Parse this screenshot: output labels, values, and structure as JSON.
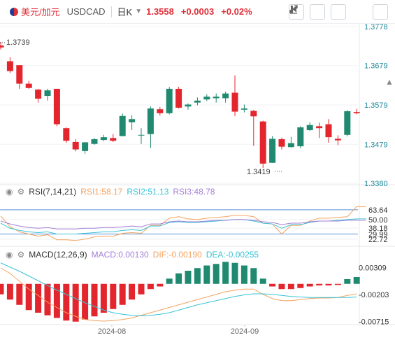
{
  "toolbar": {
    "symbol": "美元/加元",
    "code": "USDCAD",
    "period": "日K",
    "price": "1.3558",
    "change": "+0.0003",
    "change_pct": "+0.02%"
  },
  "colors": {
    "up": "#1f8a70",
    "down": "#e3262d",
    "rsi1": "#f5a25d",
    "rsi2": "#38c3d6",
    "rsi3": "#a57fd6",
    "dif": "#f5a25d",
    "dea": "#38c3d6",
    "axis_text": "#1f8a9a"
  },
  "icons": [
    "flag-icon",
    "chevron-down-icon",
    "draw-icon",
    "alert-icon",
    "settings-icon",
    "expand-icon",
    "close-icon",
    "eye-icon",
    "gear-icon"
  ],
  "chart_data": [
    {
      "type": "candlestick",
      "yticks": [
        "1.3778",
        "1.3679",
        "1.3579",
        "1.3479",
        "1.3380"
      ],
      "ylim": [
        1.338,
        1.3778
      ],
      "annotations": {
        "high_label": "1.3739",
        "low_label": "1.3419"
      },
      "candles": [
        {
          "o": 1.373,
          "h": 1.3739,
          "l": 1.372,
          "c": 1.3725
        },
        {
          "o": 1.369,
          "h": 1.37,
          "l": 1.366,
          "c": 1.3665
        },
        {
          "o": 1.368,
          "h": 1.368,
          "l": 1.362,
          "c": 1.3633
        },
        {
          "o": 1.3633,
          "h": 1.364,
          "l": 1.362,
          "c": 1.3622
        },
        {
          "o": 1.3618,
          "h": 1.362,
          "l": 1.3585,
          "c": 1.3595
        },
        {
          "o": 1.3602,
          "h": 1.362,
          "l": 1.359,
          "c": 1.3616
        },
        {
          "o": 1.362,
          "h": 1.362,
          "l": 1.3525,
          "c": 1.353
        },
        {
          "o": 1.352,
          "h": 1.3522,
          "l": 1.3483,
          "c": 1.3488
        },
        {
          "o": 1.3485,
          "h": 1.3492,
          "l": 1.3461,
          "c": 1.3466
        },
        {
          "o": 1.3462,
          "h": 1.3485,
          "l": 1.3455,
          "c": 1.3484
        },
        {
          "o": 1.348,
          "h": 1.3495,
          "l": 1.3478,
          "c": 1.3492
        },
        {
          "o": 1.349,
          "h": 1.3503,
          "l": 1.3487,
          "c": 1.3497
        },
        {
          "o": 1.3495,
          "h": 1.3505,
          "l": 1.3485,
          "c": 1.3488
        },
        {
          "o": 1.35,
          "h": 1.3557,
          "l": 1.3499,
          "c": 1.3551
        },
        {
          "o": 1.3535,
          "h": 1.3553,
          "l": 1.3515,
          "c": 1.3543
        },
        {
          "o": 1.3502,
          "h": 1.352,
          "l": 1.348,
          "c": 1.3503
        },
        {
          "o": 1.3505,
          "h": 1.3575,
          "l": 1.347,
          "c": 1.357
        },
        {
          "o": 1.3568,
          "h": 1.3574,
          "l": 1.3552,
          "c": 1.3558
        },
        {
          "o": 1.3558,
          "h": 1.3625,
          "l": 1.3555,
          "c": 1.362
        },
        {
          "o": 1.362,
          "h": 1.3625,
          "l": 1.357,
          "c": 1.3572
        },
        {
          "o": 1.3575,
          "h": 1.3583,
          "l": 1.3567,
          "c": 1.358
        },
        {
          "o": 1.3585,
          "h": 1.3598,
          "l": 1.3578,
          "c": 1.359
        },
        {
          "o": 1.3593,
          "h": 1.3606,
          "l": 1.3589,
          "c": 1.36
        },
        {
          "o": 1.3596,
          "h": 1.3608,
          "l": 1.3585,
          "c": 1.36
        },
        {
          "o": 1.3596,
          "h": 1.3613,
          "l": 1.3585,
          "c": 1.3608
        },
        {
          "o": 1.361,
          "h": 1.3654,
          "l": 1.3551,
          "c": 1.3562
        },
        {
          "o": 1.3567,
          "h": 1.358,
          "l": 1.356,
          "c": 1.357
        },
        {
          "o": 1.3564,
          "h": 1.3566,
          "l": 1.3475,
          "c": 1.355
        },
        {
          "o": 1.3537,
          "h": 1.3539,
          "l": 1.3419,
          "c": 1.343
        },
        {
          "o": 1.3432,
          "h": 1.35,
          "l": 1.3432,
          "c": 1.3493
        },
        {
          "o": 1.3492,
          "h": 1.3496,
          "l": 1.3466,
          "c": 1.3473
        },
        {
          "o": 1.3472,
          "h": 1.3498,
          "l": 1.347,
          "c": 1.3482
        },
        {
          "o": 1.3474,
          "h": 1.3525,
          "l": 1.3469,
          "c": 1.3522
        },
        {
          "o": 1.3515,
          "h": 1.3535,
          "l": 1.3513,
          "c": 1.3528
        },
        {
          "o": 1.3525,
          "h": 1.3534,
          "l": 1.3495,
          "c": 1.352
        },
        {
          "o": 1.353,
          "h": 1.3543,
          "l": 1.3483,
          "c": 1.3497
        },
        {
          "o": 1.3493,
          "h": 1.3502,
          "l": 1.3477,
          "c": 1.3489
        },
        {
          "o": 1.3503,
          "h": 1.3566,
          "l": 1.3499,
          "c": 1.3563
        },
        {
          "o": 1.3561,
          "h": 1.3569,
          "l": 1.3555,
          "c": 1.3558
        }
      ]
    },
    {
      "type": "line",
      "indicator": "RSI(7,14,21)",
      "legend": [
        "RSI1:58.17",
        "RSI2:51.13",
        "RSI3:48.78"
      ],
      "yticks": [
        "63.64",
        "50.00",
        "38.18",
        "29.99",
        "22.72"
      ],
      "levels": [
        63.64,
        50.0,
        38.18,
        29.99,
        22.72
      ],
      "ylim": [
        15,
        78
      ],
      "series": [
        {
          "name": "RSI1",
          "values": [
            55,
            40,
            33,
            30,
            27,
            29,
            22,
            22,
            21,
            23,
            26,
            27,
            27,
            31,
            32,
            31,
            42,
            42,
            52,
            54,
            51,
            50,
            52,
            53,
            54,
            56,
            56,
            54,
            45,
            44,
            30,
            42,
            42,
            48,
            52,
            52,
            53,
            54,
            68,
            68
          ]
        },
        {
          "name": "RSI2",
          "values": [
            45,
            38,
            35,
            33,
            32,
            33,
            30,
            30,
            30,
            31,
            32,
            33,
            33,
            35,
            36,
            35,
            41,
            41,
            46,
            47,
            46,
            46,
            47,
            48,
            49,
            50,
            50,
            48,
            45,
            44,
            38,
            43,
            43,
            46,
            48,
            48,
            49,
            50,
            51,
            51
          ]
        },
        {
          "name": "RSI3",
          "values": [
            48,
            44,
            41,
            39,
            38,
            39,
            37,
            37,
            37,
            38,
            38,
            39,
            39,
            40,
            41,
            40,
            44,
            44,
            47,
            48,
            47,
            47,
            48,
            49,
            49,
            50,
            50,
            49,
            47,
            46,
            43,
            45,
            45,
            47,
            48,
            48,
            48,
            49,
            49,
            49
          ]
        }
      ]
    },
    {
      "type": "bar+line",
      "indicator": "MACD(12,26,9)",
      "legend": [
        "MACD:0.00130",
        "DIF:-0.00190",
        "DEA:-0.00255"
      ],
      "yticks": [
        "0.00309",
        "-0.00203",
        "-0.00715"
      ],
      "ylim": [
        -0.0075,
        0.0045
      ],
      "macd": [
        -0.002,
        -0.003,
        -0.004,
        -0.005,
        -0.0055,
        -0.006,
        -0.0065,
        -0.007,
        -0.0072,
        -0.0068,
        -0.0062,
        -0.0055,
        -0.0048,
        -0.004,
        -0.003,
        -0.002,
        -0.001,
        -0.0005,
        0.001,
        0.002,
        0.0025,
        0.003,
        0.0035,
        0.0038,
        0.0042,
        0.004,
        0.0035,
        0.003,
        0.001,
        -0.0005,
        -0.001,
        -0.001,
        -0.0008,
        -0.0005,
        -0.0003,
        -0.0003,
        -0.0002,
        0.0009,
        0.0013
      ],
      "series": [
        {
          "name": "DIF",
          "values": [
            0.003,
            0.002,
            0.0005,
            -0.001,
            -0.0022,
            -0.0035,
            -0.0045,
            -0.0055,
            -0.0062,
            -0.0068,
            -0.007,
            -0.0071,
            -0.007,
            -0.0068,
            -0.0065,
            -0.006,
            -0.0055,
            -0.005,
            -0.0045,
            -0.004,
            -0.0035,
            -0.003,
            -0.0025,
            -0.002,
            -0.0015,
            -0.0012,
            -0.001,
            -0.001,
            -0.002,
            -0.0028,
            -0.0032,
            -0.0032,
            -0.003,
            -0.0028,
            -0.0027,
            -0.0027,
            -0.0026,
            -0.0022,
            -0.0019
          ]
        },
        {
          "name": "DEA",
          "values": [
            0.004,
            0.0032,
            0.0024,
            0.0015,
            0.0006,
            -0.0003,
            -0.0012,
            -0.002,
            -0.0028,
            -0.0036,
            -0.0043,
            -0.005,
            -0.0055,
            -0.0058,
            -0.006,
            -0.0061,
            -0.006,
            -0.0058,
            -0.0055,
            -0.005,
            -0.0045,
            -0.004,
            -0.0036,
            -0.0032,
            -0.0028,
            -0.0024,
            -0.0021,
            -0.0019,
            -0.0019,
            -0.002,
            -0.0022,
            -0.0024,
            -0.0025,
            -0.0026,
            -0.0026,
            -0.0026,
            -0.0026,
            -0.0026,
            -0.0025
          ]
        }
      ]
    }
  ],
  "x_axis": {
    "labels": [
      "2024-08",
      "2024-09"
    ]
  }
}
